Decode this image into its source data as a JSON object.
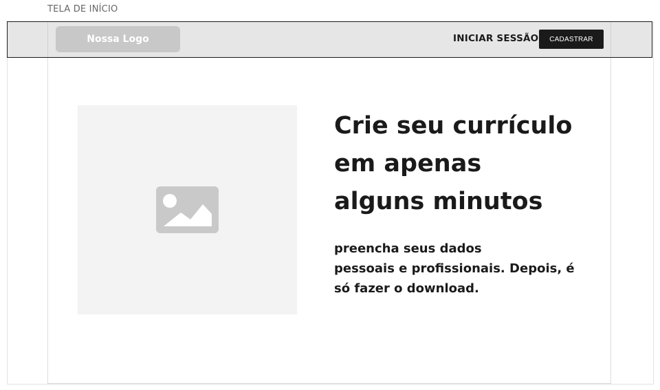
{
  "frame": {
    "label": "TELA DE INÍCIO"
  },
  "navbar": {
    "logo_text": "Nossa Logo",
    "login_label": "INICIAR SESSÃO",
    "signup_label": "CADASTRAR",
    "background_color": "#e6e6e6",
    "signup_color": "#1a1a1a"
  },
  "hero": {
    "image_icon": "image-placeholder-icon",
    "title_lines": [
      "Crie seu currículo",
      "em apenas",
      "alguns minutos"
    ],
    "subtitle_lines": [
      "preencha seus dados",
      "pessoais e profissionais. Depois, é",
      "só fazer o download."
    ]
  }
}
